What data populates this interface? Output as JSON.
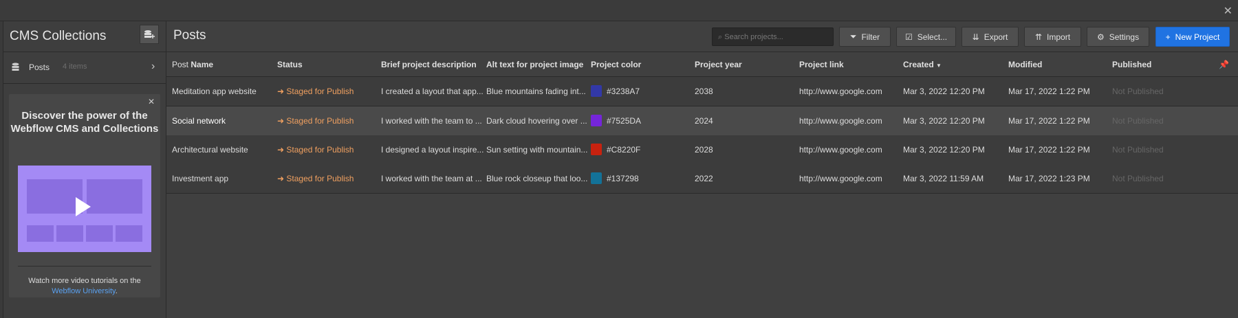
{
  "sidebar": {
    "title": "CMS Collections",
    "collections": [
      {
        "label": "Posts",
        "count": "4 items"
      }
    ],
    "promo": {
      "title": "Discover the power of the Webflow CMS and Collections",
      "footer_text": "Watch more video tutorials on the",
      "footer_link": "Webflow University",
      "footer_end": "."
    }
  },
  "main": {
    "title": "Posts",
    "search_placeholder": "Search projects...",
    "buttons": {
      "filter": "Filter",
      "select": "Select...",
      "export": "Export",
      "import": "Import",
      "settings": "Settings",
      "new_project": "New Project"
    }
  },
  "table": {
    "headers": {
      "name_prefix": "Post",
      "name": "Name",
      "status": "Status",
      "brief": "Brief project description",
      "alt": "Alt text for project image",
      "color": "Project color",
      "year": "Project year",
      "link": "Project link",
      "created": "Created",
      "modified": "Modified",
      "published": "Published"
    },
    "rows": [
      {
        "name": "Meditation app website",
        "status": "Staged for Publish",
        "brief": "I created a layout that app...",
        "alt": "Blue mountains fading int...",
        "color": "#3238A7",
        "year": "2038",
        "link": "http://www.google.com",
        "created": "Mar 3, 2022 12:20 PM",
        "modified": "Mar 17, 2022 1:22 PM",
        "published": "Not Published"
      },
      {
        "name": "Social network",
        "status": "Staged for Publish",
        "brief": "I worked with the team to ...",
        "alt": "Dark cloud hovering over ...",
        "color": "#7525DA",
        "year": "2024",
        "link": "http://www.google.com",
        "created": "Mar 3, 2022 12:20 PM",
        "modified": "Mar 17, 2022 1:22 PM",
        "published": "Not Published"
      },
      {
        "name": "Architectural website",
        "status": "Staged for Publish",
        "brief": "I designed a layout inspire...",
        "alt": "Sun setting with mountain...",
        "color": "#C8220F",
        "year": "2028",
        "link": "http://www.google.com",
        "created": "Mar 3, 2022 12:20 PM",
        "modified": "Mar 17, 2022 1:22 PM",
        "published": "Not Published"
      },
      {
        "name": "Investment app",
        "status": "Staged for Publish",
        "brief": "I worked with the team at ...",
        "alt": "Blue rock closeup that loo...",
        "color": "#137298",
        "year": "2022",
        "link": "http://www.google.com",
        "created": "Mar 3, 2022 11:59 AM",
        "modified": "Mar 17, 2022 1:23 PM",
        "published": "Not Published"
      }
    ]
  }
}
